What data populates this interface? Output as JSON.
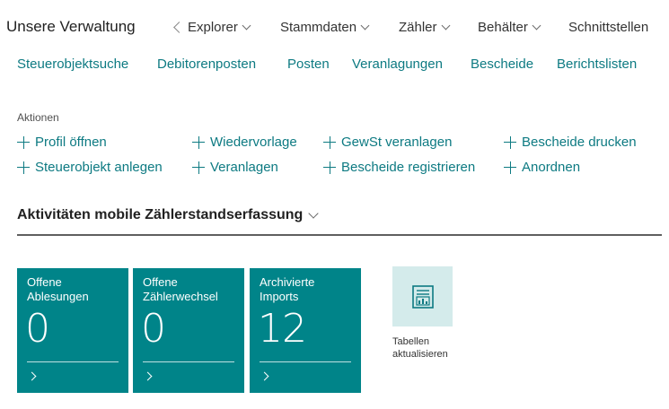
{
  "app_title": "Unsere Verwaltung",
  "top_menu": [
    {
      "label": "Explorer",
      "back": true
    },
    {
      "label": "Stammdaten"
    },
    {
      "label": "Zähler"
    },
    {
      "label": "Behälter"
    },
    {
      "label": "Schnittstellen"
    }
  ],
  "sub_nav": [
    "Steuerobjektsuche",
    "Debitorenposten",
    "Posten",
    "Veranlagungen",
    "Bescheide",
    "Berichtslisten"
  ],
  "actions": {
    "heading": "Aktionen",
    "items": [
      "Profil öffnen",
      "Wiedervorlage",
      "GewSt veranlagen",
      "Bescheide drucken",
      "Steuerobjekt anlegen",
      "Veranlagen",
      "Bescheide registrieren",
      "Anordnen"
    ]
  },
  "section": {
    "title": "Aktivitäten mobile Zählerstandserfassung",
    "tiles": [
      {
        "title": "Offene Ablesungen",
        "value": "0"
      },
      {
        "title": "Offene Zählerwechsel",
        "value": "0"
      },
      {
        "title": "Archivierte Imports",
        "value": "12"
      }
    ],
    "refresh_label": "Tabellen aktualisieren",
    "refresh_icon": "report-refresh-icon"
  },
  "colors": {
    "accent": "#0d7a82",
    "tile": "#008489",
    "tile_light": "#d4ebeb"
  }
}
